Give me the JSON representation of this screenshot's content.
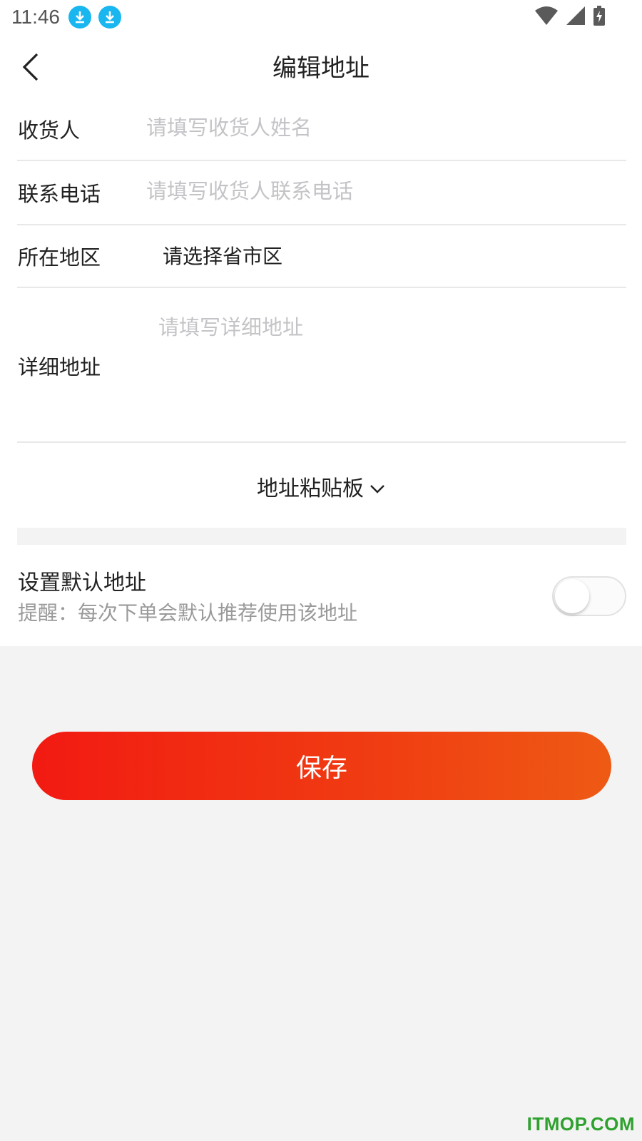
{
  "status_bar": {
    "time": "11:46",
    "notification_icons": [
      "download-icon",
      "download-icon"
    ],
    "system_icons": [
      "wifi-icon",
      "signal-icon",
      "battery-charging-icon"
    ]
  },
  "header": {
    "back_icon": "chevron-left-icon",
    "title": "编辑地址"
  },
  "form": {
    "recipient": {
      "label": "收货人",
      "value": "",
      "placeholder": "请填写收货人姓名"
    },
    "phone": {
      "label": "联系电话",
      "value": "",
      "placeholder": "请填写收货人联系电话"
    },
    "region": {
      "label": "所在地区",
      "value": "请选择省市区"
    },
    "detail": {
      "label": "详细地址",
      "value": "",
      "placeholder": "请填写详细地址"
    }
  },
  "paste_board": {
    "label": "地址粘贴板",
    "icon": "chevron-down-icon"
  },
  "default_address": {
    "title": "设置默认地址",
    "hint": "提醒：每次下单会默认推荐使用该地址",
    "enabled": false
  },
  "save_button": {
    "label": "保存"
  },
  "watermark": "ITMOP.COM",
  "colors": {
    "accent_start": "#f21a12",
    "accent_end": "#ee5a14",
    "placeholder": "#c4c4c8",
    "background": "#f3f3f3"
  }
}
